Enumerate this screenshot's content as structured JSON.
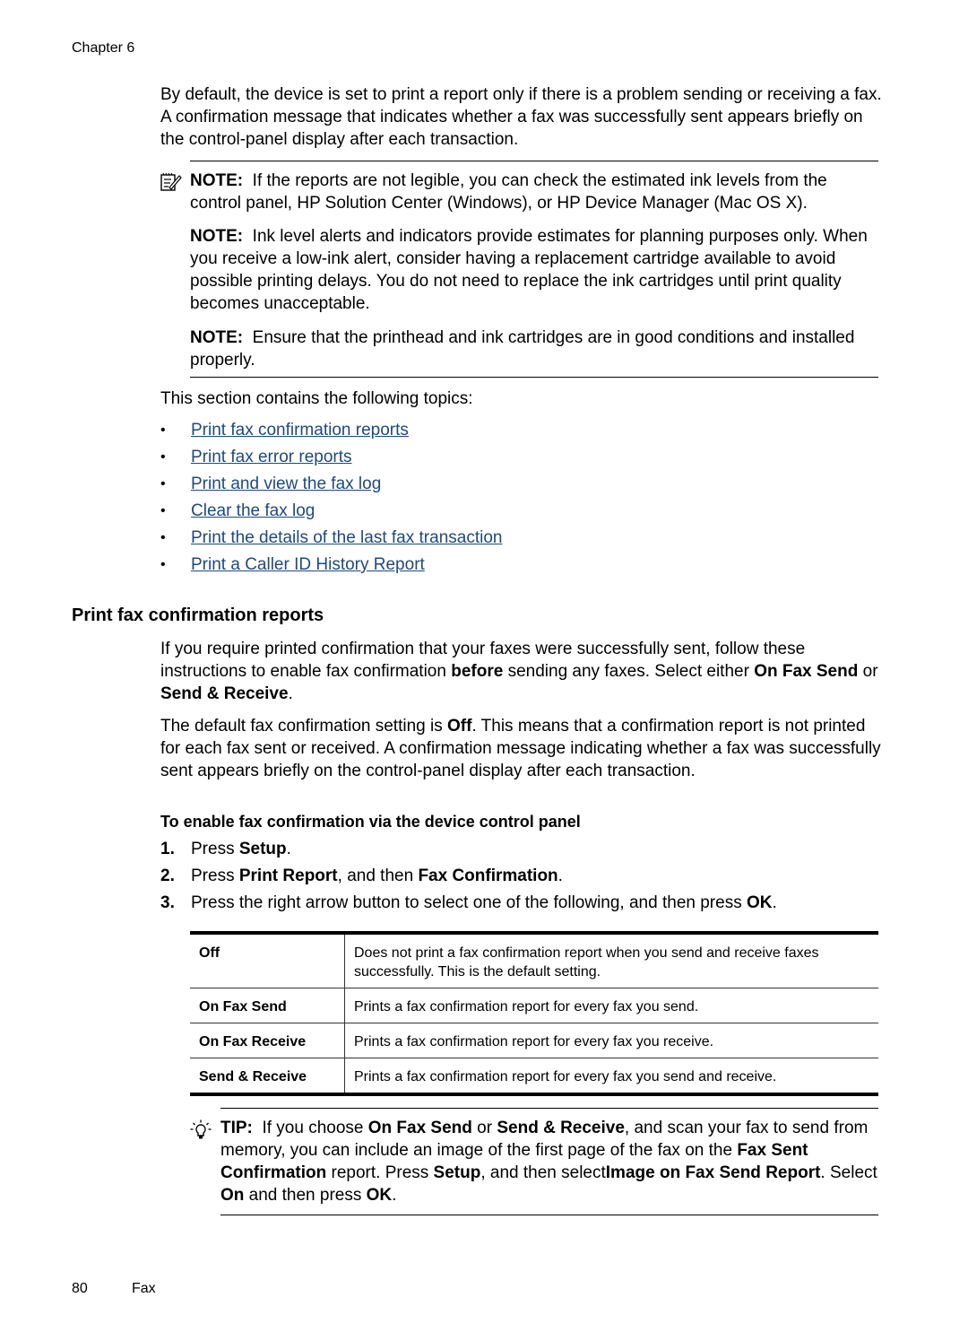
{
  "header": {
    "chapter": "Chapter 6"
  },
  "intro": {
    "text": "By default, the device is set to print a report only if there is a problem sending or receiving a fax. A confirmation message that indicates whether a fax was successfully sent appears briefly on the control-panel display after each transaction."
  },
  "notes": [
    {
      "label": "NOTE:",
      "text": "If the reports are not legible, you can check the estimated ink levels from the control panel, HP Solution Center (Windows), or HP Device Manager (Mac OS X)."
    },
    {
      "label": "NOTE:",
      "text": "Ink level alerts and indicators provide estimates for planning purposes only. When you receive a low-ink alert, consider having a replacement cartridge available to avoid possible printing delays. You do not need to replace the ink cartridges until print quality becomes unacceptable."
    },
    {
      "label": "NOTE:",
      "text": "Ensure that the printhead and ink cartridges are in good conditions and installed properly."
    }
  ],
  "topics": {
    "intro": "This section contains the following topics:",
    "bullet": "•",
    "links": [
      "Print fax confirmation reports",
      "Print fax error reports",
      "Print and view the fax log",
      "Clear the fax log",
      "Print the details of the last fax transaction",
      "Print a Caller ID History Report"
    ]
  },
  "section": {
    "title": "Print fax confirmation reports",
    "p1": {
      "a": "If you require printed confirmation that your faxes were successfully sent, follow these instructions to enable fax confirmation ",
      "b1": "before",
      "c": " sending any faxes. Select either ",
      "b2": "On Fax Send",
      "d": " or ",
      "b3": "Send & Receive",
      "e": "."
    },
    "p2": {
      "a": "The default fax confirmation setting is ",
      "b1": "Off",
      "c": ". This means that a confirmation report is not printed for each fax sent or received. A confirmation message indicating whether a fax was successfully sent appears briefly on the control-panel display after each transaction."
    },
    "procedure_title": "To enable fax confirmation via the device control panel",
    "steps": [
      {
        "num": "1.",
        "a": "Press ",
        "b": "Setup",
        "c": "."
      },
      {
        "num": "2.",
        "a": "Press ",
        "b": "Print Report",
        "c": ", and then ",
        "d": "Fax Confirmation",
        "e": "."
      },
      {
        "num": "3.",
        "a": "Press the right arrow button to select one of the following, and then press ",
        "b": "OK",
        "c": "."
      }
    ],
    "options": [
      {
        "name": "Off",
        "desc": "Does not print a fax confirmation report when you send and receive faxes successfully. This is the default setting."
      },
      {
        "name": "On Fax Send",
        "desc": "Prints a fax confirmation report for every fax you send."
      },
      {
        "name": "On Fax Receive",
        "desc": "Prints a fax confirmation report for every fax you receive."
      },
      {
        "name": "Send & Receive",
        "desc": "Prints a fax confirmation report for every fax you send and receive."
      }
    ],
    "tip": {
      "label": "TIP:",
      "a": "If you choose ",
      "b1": "On Fax Send",
      "c": " or ",
      "b2": "Send & Receive",
      "d": ", and scan your fax to send from memory, you can include an image of the first page of the fax on the ",
      "b3": "Fax Sent Confirmation",
      "e": " report. Press ",
      "b4": "Setup",
      "f": ", and then select",
      "b5": "Image on Fax Send Report",
      "g": ". Select ",
      "b6": "On",
      "h": " and then press ",
      "b7": "OK",
      "i": "."
    }
  },
  "footer": {
    "page_number": "80",
    "section": "Fax"
  }
}
